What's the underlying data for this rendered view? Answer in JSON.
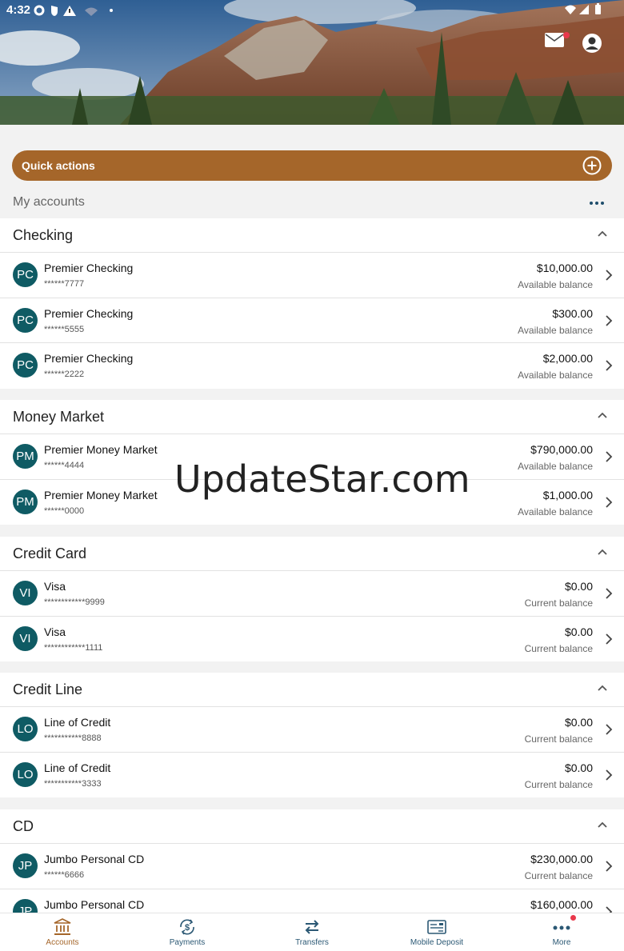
{
  "status_bar": {
    "time": "4:32"
  },
  "header": {
    "mail_has_notification": true
  },
  "quick_actions": {
    "label": "Quick actions"
  },
  "my_accounts": {
    "label": "My accounts"
  },
  "groups": [
    {
      "title": "Checking",
      "accounts": [
        {
          "initials": "PC",
          "name": "Premier Checking",
          "number": "******7777",
          "amount": "$10,000.00",
          "balance_label": "Available balance"
        },
        {
          "initials": "PC",
          "name": "Premier Checking",
          "number": "******5555",
          "amount": "$300.00",
          "balance_label": "Available balance"
        },
        {
          "initials": "PC",
          "name": "Premier Checking",
          "number": "******2222",
          "amount": "$2,000.00",
          "balance_label": "Available balance"
        }
      ]
    },
    {
      "title": "Money Market",
      "accounts": [
        {
          "initials": "PM",
          "name": "Premier Money Market",
          "number": "******4444",
          "amount": "$790,000.00",
          "balance_label": "Available balance"
        },
        {
          "initials": "PM",
          "name": "Premier Money Market",
          "number": "******0000",
          "amount": "$1,000.00",
          "balance_label": "Available balance"
        }
      ]
    },
    {
      "title": "Credit Card",
      "accounts": [
        {
          "initials": "VI",
          "name": "Visa",
          "number": "************9999",
          "amount": "$0.00",
          "balance_label": "Current balance"
        },
        {
          "initials": "VI",
          "name": "Visa",
          "number": "************1111",
          "amount": "$0.00",
          "balance_label": "Current balance"
        }
      ]
    },
    {
      "title": "Credit Line",
      "accounts": [
        {
          "initials": "LO",
          "name": "Line of Credit",
          "number": "***********8888",
          "amount": "$0.00",
          "balance_label": "Current balance"
        },
        {
          "initials": "LO",
          "name": "Line of Credit",
          "number": "***********3333",
          "amount": "$0.00",
          "balance_label": "Current balance"
        }
      ]
    },
    {
      "title": "CD",
      "accounts": [
        {
          "initials": "JP",
          "name": "Jumbo Personal CD",
          "number": "******6666",
          "amount": "$230,000.00",
          "balance_label": "Current balance"
        },
        {
          "initials": "JP",
          "name": "Jumbo Personal CD",
          "number": "",
          "amount": "$160,000.00",
          "balance_label": ""
        }
      ]
    }
  ],
  "watermark": "UpdateStar.com",
  "bottom_nav": [
    {
      "label": "Accounts",
      "icon": "bank-icon",
      "active": true
    },
    {
      "label": "Payments",
      "icon": "payments-icon",
      "active": false
    },
    {
      "label": "Transfers",
      "icon": "transfer-arrows-icon",
      "active": false
    },
    {
      "label": "Mobile Deposit",
      "icon": "check-deposit-icon",
      "active": false
    },
    {
      "label": "More",
      "icon": "more-dots-icon",
      "active": false,
      "has_notification": true
    }
  ],
  "colors": {
    "accent": "#a5662a",
    "avatar": "#0f5b64",
    "nav": "#2b5874",
    "notification": "#e9384b"
  }
}
